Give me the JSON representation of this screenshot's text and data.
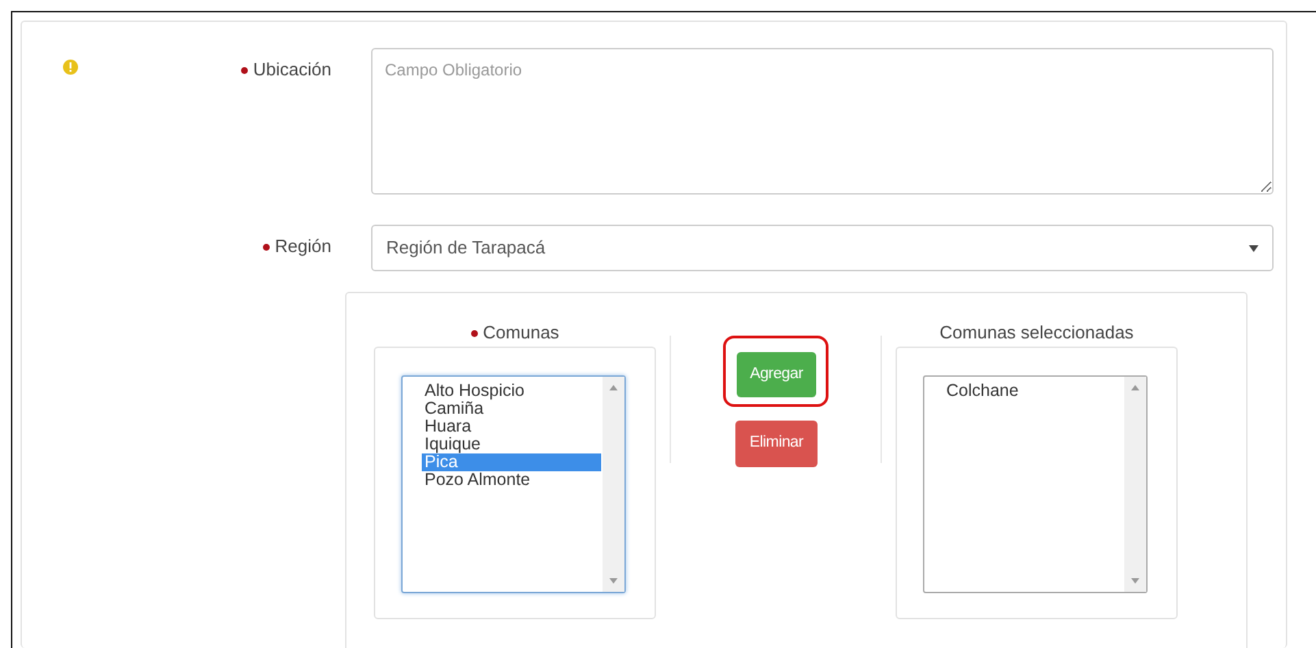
{
  "fields": [
    {
      "kind": "textarea",
      "label": "Ubicación",
      "required": true,
      "placeholder": "Campo Obligatorio"
    },
    {
      "kind": "select",
      "label": "Región",
      "required": true,
      "value": "Región de Tarapacá"
    }
  ],
  "available": {
    "title": "Comunas",
    "required": true,
    "options": [
      {
        "label": "Alto Hospicio",
        "selected": false
      },
      {
        "label": "Camiña",
        "selected": false
      },
      {
        "label": "Huara",
        "selected": false
      },
      {
        "label": "Iquique",
        "selected": false
      },
      {
        "label": "Pica",
        "selected": true
      },
      {
        "label": "Pozo Almonte",
        "selected": false
      }
    ]
  },
  "buttons": [
    {
      "label": "Agregar",
      "kind": "add",
      "highlighted": true
    },
    {
      "label": "Eliminar",
      "kind": "remove",
      "highlighted": false
    }
  ],
  "chosen": {
    "title": "Comunas seleccionadas",
    "required": false,
    "options": [
      {
        "label": "Colchane",
        "selected": false
      }
    ]
  }
}
